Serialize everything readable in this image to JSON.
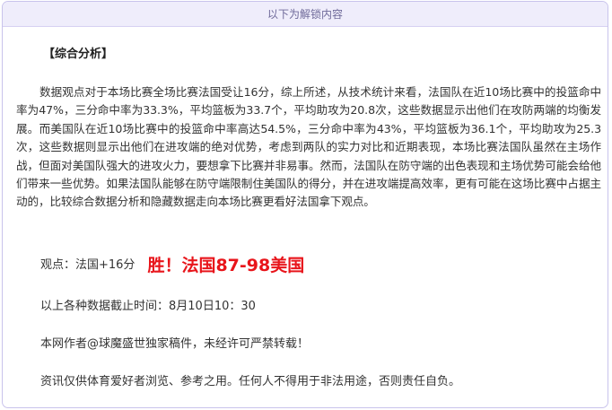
{
  "unlock_bar": {
    "label": "以下为解锁内容"
  },
  "article": {
    "section_title": "【综合分析】",
    "paragraph": "数据观点对于本场比赛全场比赛法国受让16分，综上所述，从技术统计来看，法国队在近10场比赛中的投篮命中率为47%，三分命中率为33.3%，平均篮板为33.7个，平均助攻为20.8次，这些数据显示出他们在攻防两端的均衡发展。而美国队在近10场比赛中的投篮命中率高达54.5%，三分命中率为43%，平均篮板为36.1个，平均助攻为25.3次，这些数据则显示出他们在进攻端的绝对优势，考虑到两队的实力对比和近期表现，本场比赛法国队虽然在主场作战，但面对美国队强大的进攻火力，要想拿下比赛并非易事。然而，法国队在防守端的出色表现和主场优势可能会给他们带来一些优势。如果法国队能够在防守端限制住美国队的得分，并在进攻端提高效率，更有可能在这场比赛中占据主动的，比较综合数据分析和隐藏数据走向本场比赛更看好法国拿下观点。",
    "view_label": "观点：法国+16分",
    "view_result": "胜！法国87-98美国",
    "cutoff": "以上各种数据截止时间：8月10日10：30",
    "copyright": "本网作者@球魔盛世独家稿件，未经许可严禁转载！",
    "disclaimer": "资讯仅供体育爱好者浏览、参考之用。任何人不得用于非法用途，否则责任自负。"
  }
}
